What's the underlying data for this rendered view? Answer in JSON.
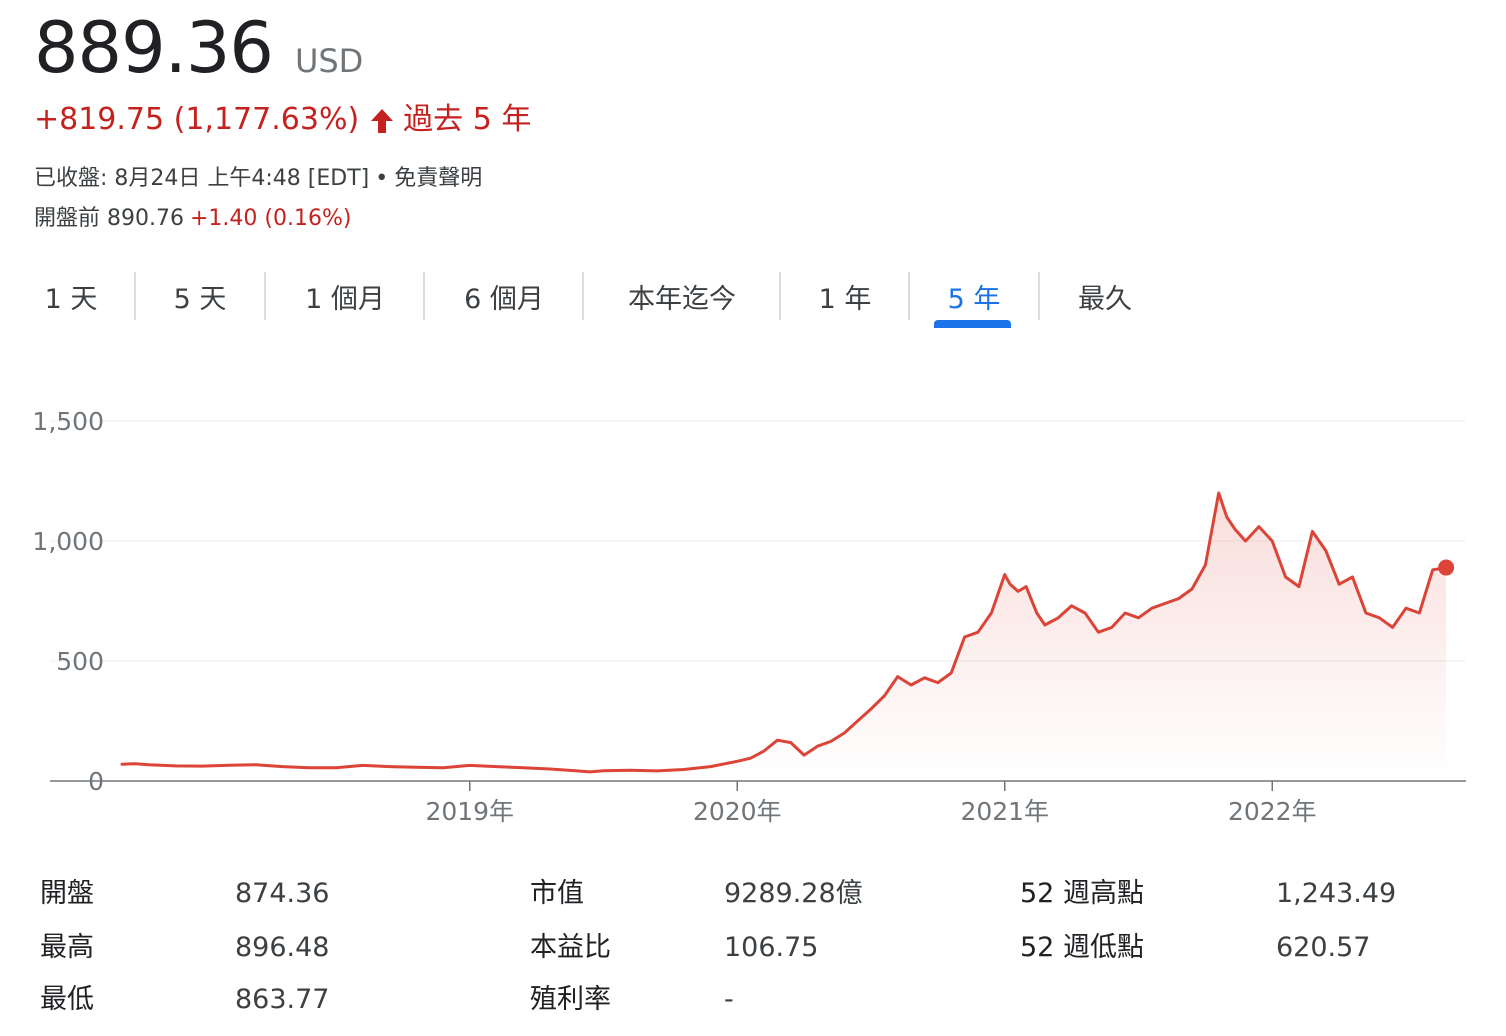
{
  "header": {
    "price": "889.36",
    "currency": "USD",
    "change": "+819.75 (1,177.63%)",
    "period": "過去 5 年",
    "closed_label": "已收盤: 8月24日 上午4:48 [EDT]",
    "separator": "•",
    "disclaimer": "免責聲明",
    "premarket_label": "開盤前 890.76",
    "premarket_change": "+1.40 (0.16%)"
  },
  "tabs": [
    {
      "label": "1 天",
      "active": false
    },
    {
      "label": "5 天",
      "active": false
    },
    {
      "label": "1 個月",
      "active": false
    },
    {
      "label": "6 個月",
      "active": false
    },
    {
      "label": "本年迄今",
      "active": false
    },
    {
      "label": "1 年",
      "active": false
    },
    {
      "label": "5 年",
      "active": true
    },
    {
      "label": "最久",
      "active": false
    }
  ],
  "colors": {
    "line": "#db4437",
    "negative": "#c5221f",
    "accent": "#1a73e8"
  },
  "chart_data": {
    "type": "area",
    "ylim": [
      0,
      1500
    ],
    "y_ticks": [
      0,
      500,
      1000,
      1500
    ],
    "y_tick_labels": [
      "0",
      "500",
      "1,000",
      "1,500"
    ],
    "xlim": [
      2017.67,
      2022.68
    ],
    "x_ticks": [
      2019,
      2020,
      2021,
      2022
    ],
    "x_tick_labels": [
      "2019年",
      "2020年",
      "2021年",
      "2022年"
    ],
    "grid": true,
    "series": [
      {
        "x": [
          2017.7,
          2017.75,
          2017.8,
          2017.9,
          2018.0,
          2018.1,
          2018.2,
          2018.3,
          2018.4,
          2018.5,
          2018.6,
          2018.7,
          2018.8,
          2018.9,
          2019.0,
          2019.1,
          2019.2,
          2019.3,
          2019.4,
          2019.45,
          2019.5,
          2019.6,
          2019.7,
          2019.8,
          2019.9,
          2020.0,
          2020.05,
          2020.1,
          2020.15,
          2020.2,
          2020.25,
          2020.3,
          2020.35,
          2020.4,
          2020.45,
          2020.5,
          2020.55,
          2020.6,
          2020.65,
          2020.7,
          2020.75,
          2020.8,
          2020.85,
          2020.9,
          2020.95,
          2021.0,
          2021.02,
          2021.05,
          2021.08,
          2021.12,
          2021.15,
          2021.2,
          2021.25,
          2021.3,
          2021.35,
          2021.4,
          2021.45,
          2021.5,
          2021.55,
          2021.6,
          2021.65,
          2021.7,
          2021.75,
          2021.8,
          2021.83,
          2021.86,
          2021.9,
          2021.95,
          2022.0,
          2022.05,
          2022.1,
          2022.15,
          2022.2,
          2022.25,
          2022.3,
          2022.35,
          2022.4,
          2022.45,
          2022.5,
          2022.55,
          2022.6,
          2022.65
        ],
        "y": [
          70,
          72,
          68,
          63,
          62,
          66,
          68,
          60,
          55,
          55,
          65,
          60,
          57,
          55,
          65,
          60,
          55,
          50,
          42,
          38,
          43,
          45,
          42,
          48,
          60,
          82,
          95,
          125,
          170,
          160,
          108,
          145,
          165,
          200,
          250,
          300,
          355,
          435,
          400,
          430,
          410,
          450,
          600,
          620,
          700,
          860,
          820,
          790,
          810,
          700,
          650,
          680,
          730,
          700,
          620,
          640,
          700,
          680,
          720,
          740,
          760,
          800,
          900,
          1200,
          1100,
          1050,
          1000,
          1060,
          1000,
          850,
          810,
          1040,
          960,
          820,
          850,
          700,
          680,
          640,
          720,
          700,
          880,
          889.36
        ]
      }
    ]
  },
  "stats": [
    {
      "label": "開盤",
      "value": "874.36"
    },
    {
      "label": "最高",
      "value": "896.48"
    },
    {
      "label": "最低",
      "value": "863.77"
    },
    {
      "label": "市值",
      "value": "9289.28億"
    },
    {
      "label": "本益比",
      "value": "106.75"
    },
    {
      "label": "殖利率",
      "value": "-"
    },
    {
      "label": "52 週高點",
      "value": "1,243.49"
    },
    {
      "label": "52 週低點",
      "value": "620.57"
    }
  ]
}
